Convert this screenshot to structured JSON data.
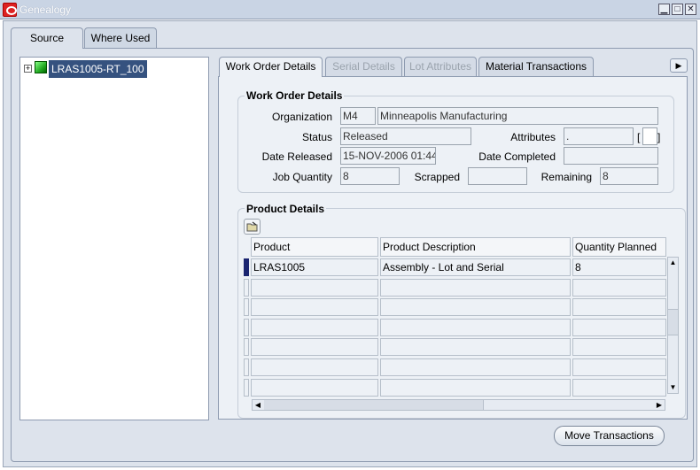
{
  "window": {
    "title": "Genealogy",
    "minimize": "▁",
    "maximize": "□",
    "close": "✕"
  },
  "main_tabs": [
    {
      "label": "Source",
      "active": true
    },
    {
      "label": "Where Used",
      "active": false
    }
  ],
  "tree": {
    "expander": "+",
    "node_label": "LRAS1005-RT_100"
  },
  "detail_tabs": [
    {
      "label": "Work Order Details",
      "active": true
    },
    {
      "label": "Serial Details",
      "active": false
    },
    {
      "label": "Lot Attributes",
      "active": false
    },
    {
      "label": "Material Transactions",
      "active": false
    }
  ],
  "tab_scroll_arrow": "▶",
  "work_order": {
    "section_title": "Work Order Details",
    "organization_label": "Organization",
    "organization_code": "M4",
    "organization_name": "Minneapolis Manufacturing",
    "status_label": "Status",
    "status_value": "Released",
    "attributes_label": "Attributes",
    "attributes_value": ".",
    "attributes_bracket_open": "[",
    "attributes_bracket_close": "]",
    "date_released_label": "Date Released",
    "date_released_value": "15-NOV-2006 01:44",
    "date_completed_label": "Date Completed",
    "date_completed_value": "",
    "job_quantity_label": "Job Quantity",
    "job_quantity_value": "8",
    "scrapped_label": "Scrapped",
    "scrapped_value": "",
    "remaining_label": "Remaining",
    "remaining_value": "8"
  },
  "product": {
    "section_title": "Product Details",
    "columns": [
      "Product",
      "Product Description",
      "Quantity Planned"
    ],
    "rows": [
      [
        "LRAS1005",
        "Assembly - Lot and Serial",
        "8"
      ],
      [
        "",
        "",
        ""
      ],
      [
        "",
        "",
        ""
      ],
      [
        "",
        "",
        ""
      ],
      [
        "",
        "",
        ""
      ],
      [
        "",
        "",
        ""
      ],
      [
        "",
        "",
        ""
      ]
    ]
  },
  "scroll": {
    "up": "▲",
    "down": "▼",
    "left": "◀",
    "right": "▶"
  },
  "move_button": "Move Transactions"
}
